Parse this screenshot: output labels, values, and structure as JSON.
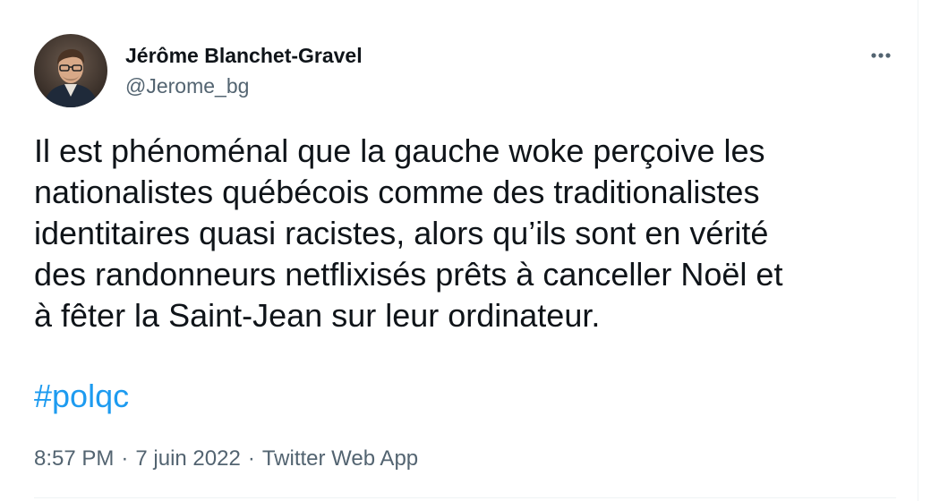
{
  "tweet": {
    "author": {
      "display_name": "Jérôme Blanchet-Gravel",
      "handle": "@Jerome_bg",
      "avatar_icon": "user-avatar-photo"
    },
    "more_icon": "more-horizontal-icon",
    "text": "Il est phénoménal que la gauche woke perçoive les\nnationalistes québécois comme des traditionalistes\nidentitaires quasi racistes, alors qu’ils sont en vérité\ndes randonneurs netflixisés prêts à canceller Noël et\nà fêter la Saint-Jean sur leur ordinateur.",
    "hashtag": "#polqc",
    "time": "8:57 PM",
    "date": "7 juin 2022",
    "separator": "·",
    "source": "Twitter Web App"
  },
  "colors": {
    "text_primary": "#0f1419",
    "text_secondary": "#536471",
    "link": "#1d9bf0",
    "divider": "#eff3f4"
  }
}
